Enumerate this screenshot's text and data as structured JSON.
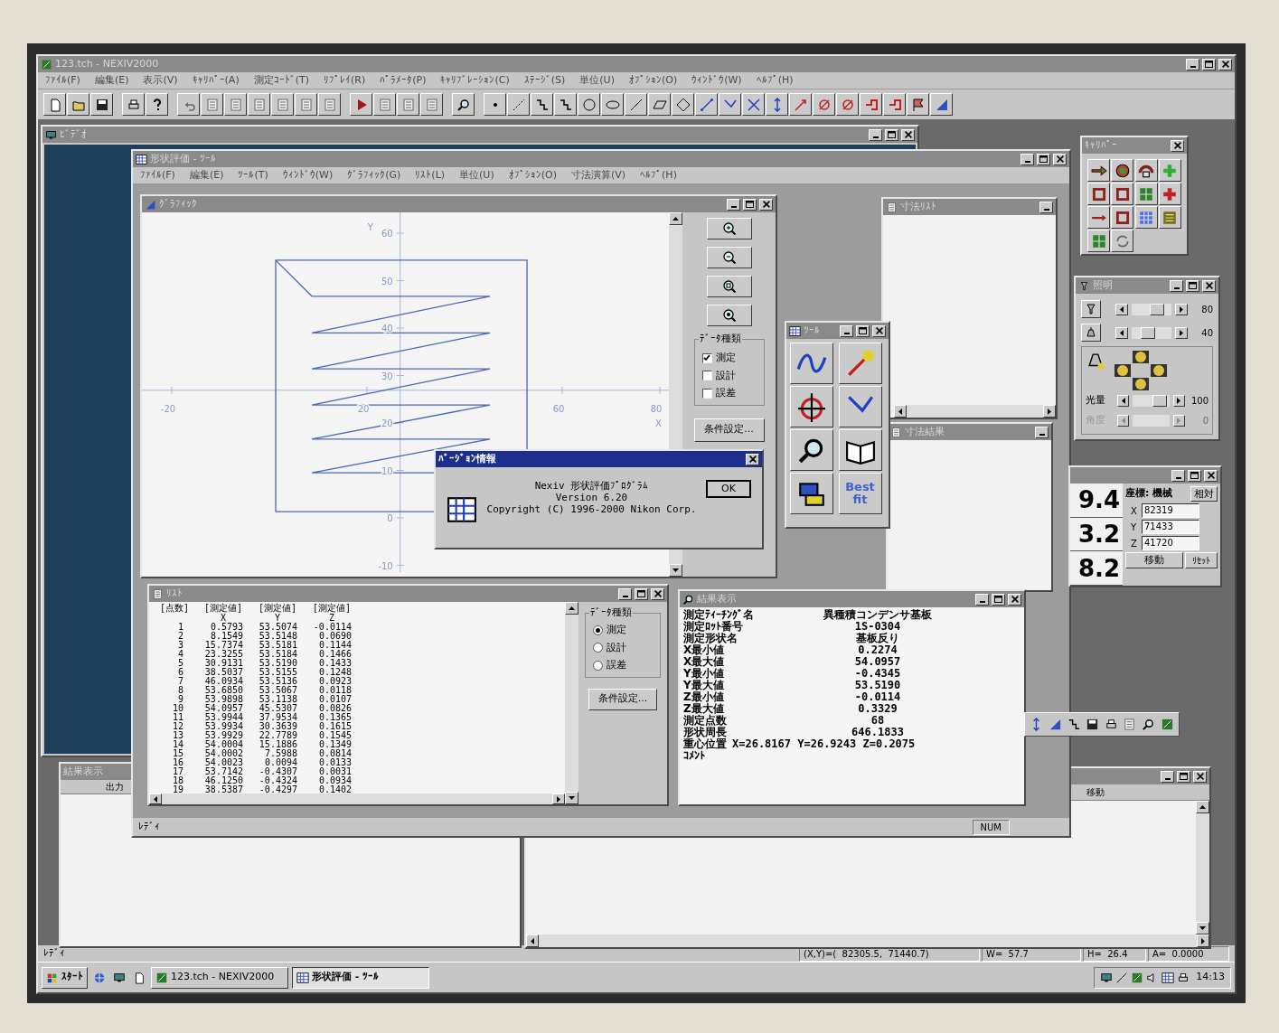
{
  "app": {
    "title": "123.tch - NEXIV2000",
    "menu": [
      "ﾌｧｲﾙ(F)",
      "編集(E)",
      "表示(V)",
      "ｷｬﾘﾊﾟｰ(A)",
      "測定ｺｰﾄﾞ(T)",
      "ﾘﾌﾟﾚｲ(R)",
      "ﾊﾟﾗﾒｰﾀ(P)",
      "ｷｬﾘﾌﾞﾚｰｼｮﾝ(C)",
      "ｽﾃｰｼﾞ(S)",
      "単位(U)",
      "ｵﾌﾟｼｮﾝ(O)",
      "ｳｨﾝﾄﾞｳ(W)",
      "ﾍﾙﾌﾟ(H)"
    ]
  },
  "video_window": {
    "title": "ﾋﾞﾃﾞｵ"
  },
  "tool_window": {
    "title": "形状評価 - ﾂｰﾙ",
    "menu": [
      "ﾌｧｲﾙ(F)",
      "編集(E)",
      "ﾂｰﾙ(T)",
      "ｳｨﾝﾄﾞｳ(W)",
      "ｸﾞﾗﾌｨｯｸ(G)",
      "ﾘｽﾄ(L)",
      "単位(U)",
      "ｵﾌﾟｼｮﾝ(O)",
      "寸法演算(V)",
      "ﾍﾙﾌﾟ(H)"
    ],
    "status": "ﾚﾃﾞｨ",
    "indicator": "NUM"
  },
  "graphic_window": {
    "title": "ｸﾞﾗﾌｨｯｸ",
    "axes": {
      "x_label": "X",
      "y_label": "Y",
      "x_ticks": [
        "-20",
        "20",
        "60",
        "80"
      ],
      "y_ticks": [
        "60",
        "50",
        "40",
        "30",
        "20",
        "10",
        "0",
        "-10"
      ]
    },
    "data_type": {
      "label": "ﾃﾞｰﾀ種類",
      "options": [
        {
          "label": "測定",
          "checked": true
        },
        {
          "label": "設計",
          "checked": false
        },
        {
          "label": "誤差",
          "checked": false
        }
      ]
    },
    "settings_button": "条件設定..."
  },
  "dimension_list_window": {
    "title": "寸法ﾘｽﾄ"
  },
  "dimension_result_window": {
    "title": "寸法結果"
  },
  "tool_palette": {
    "title": "ﾂｰﾙ",
    "best_fit": "Best fit"
  },
  "version_dialog": {
    "title": "ﾊﾞｰｼﾞｮﾝ情報",
    "lines": [
      "Nexiv 形状評価ﾌﾟﾛｸﾞﾗﾑ",
      "Version 6.20",
      "Copyright (C) 1996-2000 Nikon Corp."
    ],
    "ok_button": "OK"
  },
  "list_window": {
    "title": "ﾘｽﾄ",
    "columns": [
      {
        "label": "[点数]"
      },
      {
        "label": "[測定値]",
        "axis": "X"
      },
      {
        "label": "[測定値]",
        "axis": "Y"
      },
      {
        "label": "[測定値]",
        "axis": "Z"
      }
    ],
    "rows": [
      [
        "1",
        "0.5793",
        "53.5074",
        "-0.0114"
      ],
      [
        "2",
        "8.1549",
        "53.5148",
        "0.0690"
      ],
      [
        "3",
        "15.7374",
        "53.5181",
        "0.1144"
      ],
      [
        "4",
        "23.3255",
        "53.5184",
        "0.1466"
      ],
      [
        "5",
        "30.9131",
        "53.5190",
        "0.1433"
      ],
      [
        "6",
        "38.5037",
        "53.5155",
        "0.1248"
      ],
      [
        "7",
        "46.0934",
        "53.5136",
        "0.0923"
      ],
      [
        "8",
        "53.6850",
        "53.5067",
        "0.0118"
      ],
      [
        "9",
        "53.9898",
        "53.1138",
        "0.0107"
      ],
      [
        "10",
        "54.0957",
        "45.5307",
        "0.0826"
      ],
      [
        "11",
        "53.9944",
        "37.9534",
        "0.1365"
      ],
      [
        "12",
        "53.9934",
        "30.3639",
        "0.1615"
      ],
      [
        "13",
        "53.9929",
        "22.7789",
        "0.1545"
      ],
      [
        "14",
        "54.0004",
        "15.1886",
        "0.1349"
      ],
      [
        "15",
        "54.0002",
        "7.5988",
        "0.0814"
      ],
      [
        "16",
        "54.0023",
        "0.0094",
        "0.0133"
      ],
      [
        "17",
        "53.7142",
        "-0.4307",
        "0.0031"
      ],
      [
        "18",
        "46.1250",
        "-0.4324",
        "0.0934"
      ],
      [
        "19",
        "38.5387",
        "-0.4297",
        "0.1402"
      ]
    ],
    "data_type": {
      "label": "ﾃﾞｰﾀ種類",
      "options": [
        {
          "label": "測定",
          "selected": true
        },
        {
          "label": "設計",
          "selected": false
        },
        {
          "label": "誤差",
          "selected": false
        }
      ]
    },
    "settings_button": "条件設定..."
  },
  "result_window": {
    "title": "結果表示",
    "rows": [
      {
        "kind": "field",
        "label": "測定ﾃｨｰﾁﾝｸﾞ名",
        "value": "異種積コンデンサ基板"
      },
      {
        "kind": "field",
        "label": "測定ﾛｯﾄ番号",
        "value": "1S-0304"
      },
      {
        "kind": "field",
        "label": "測定形状名",
        "value": "基板反り"
      },
      {
        "kind": "field",
        "label": "X最小値",
        "value": "0.2274"
      },
      {
        "kind": "field",
        "label": "X最大値",
        "value": "54.0957"
      },
      {
        "kind": "field",
        "label": "Y最小値",
        "value": "-0.4345"
      },
      {
        "kind": "field",
        "label": "Y最大値",
        "value": "53.5190"
      },
      {
        "kind": "field",
        "label": "Z最小値",
        "value": "-0.0114"
      },
      {
        "kind": "field",
        "label": "Z最大値",
        "value": "0.3329"
      },
      {
        "kind": "field",
        "label": "測定点数",
        "value": "68"
      },
      {
        "kind": "field",
        "label": "形状周長",
        "value": "646.1833"
      },
      {
        "kind": "inline",
        "label": "重心位置",
        "value": "X=26.8167 Y=26.9243 Z=0.2075"
      },
      {
        "kind": "field",
        "label": "ｺﾒﾝﾄ"
      }
    ]
  },
  "caliper_palette": {
    "title": "ｷｬﾘﾊﾟｰ"
  },
  "lighting_window": {
    "title": "照明",
    "sliders": [
      {
        "kind": "icon",
        "level": 0.72,
        "reading": "80",
        "disabled": false
      },
      {
        "kind": "icon",
        "level": 0.35,
        "reading": "40",
        "disabled": false
      },
      {
        "kind": "labeled",
        "label": "光量",
        "level": 0.78,
        "reading": "100",
        "disabled": false
      },
      {
        "kind": "labeled",
        "label": "角度",
        "reading": "0",
        "disabled": true
      }
    ]
  },
  "coordinate_window": {
    "readouts": [
      "9.4",
      "3.2",
      "8.2"
    ],
    "frame_label": "座標: 機械",
    "relative_button": "相対",
    "fields": [
      {
        "label": "X",
        "value": "82319"
      },
      {
        "label": "Y",
        "value": "71433"
      },
      {
        "label": "Z",
        "value": "41720"
      }
    ],
    "move_button": "移動",
    "reset_button": "ﾘｾｯﾄ"
  },
  "lower_result_window": {
    "title": "結果表示",
    "header": "出力"
  },
  "lower_right_window": {
    "header": "移動"
  },
  "status_bar": {
    "text": "ﾚﾃﾞｨ",
    "cells": [
      "(X,Y)=(  82305.5,  71440.7)",
      "W=  57.7",
      "H=  26.4",
      "A=  0.0000"
    ]
  },
  "taskbar": {
    "start": "ｽﾀｰﾄ",
    "tasks": [
      {
        "label": "123.tch - NEXIV2000",
        "selected": false
      },
      {
        "label": "形状評価 - ﾂｰﾙ",
        "selected": true
      }
    ],
    "clock": "14:13"
  }
}
